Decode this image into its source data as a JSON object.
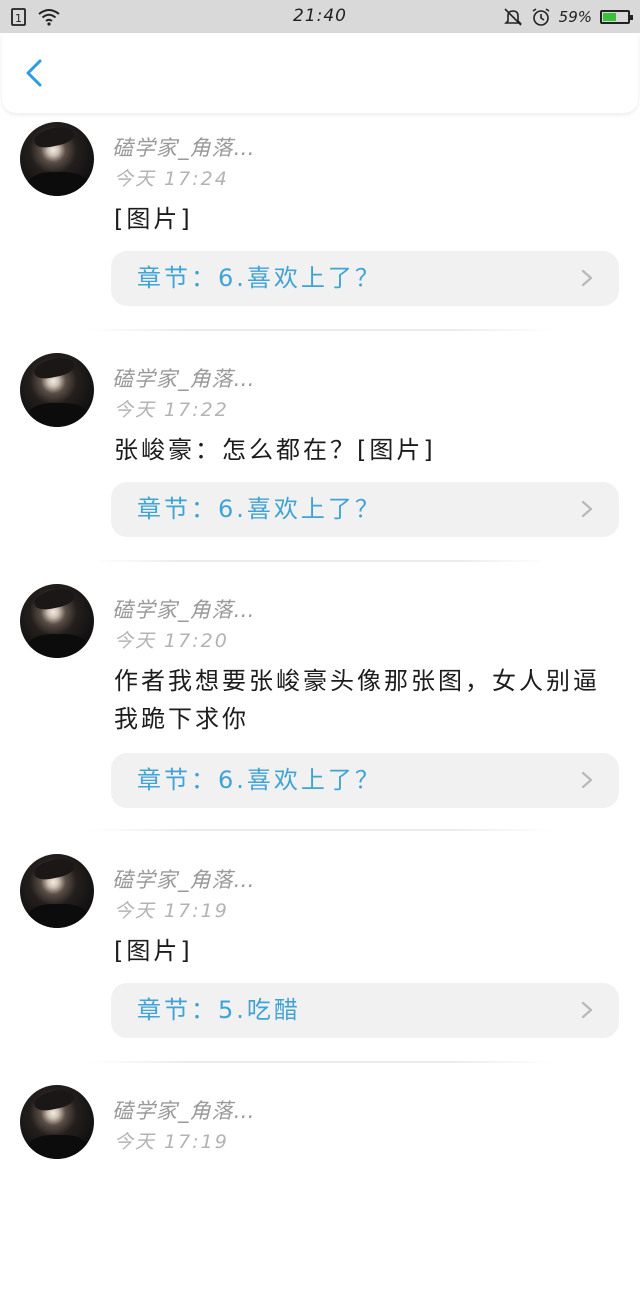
{
  "status_bar": {
    "time": "21:40",
    "battery_percent": "59%",
    "battery_level": 0.59,
    "battery_color": "#39c239",
    "icons": [
      "sim-card-icon",
      "wifi-icon",
      "mute-bell-icon",
      "alarm-clock-icon",
      "battery-icon"
    ]
  },
  "header": {
    "back_icon": "back-chevron-icon",
    "accent_color": "#2b9be8"
  },
  "comments": [
    {
      "username": "磕学家_角落…",
      "timestamp": "今天 17:24",
      "content": "[图片]",
      "chapter": "章节：6.喜欢上了？"
    },
    {
      "username": "磕学家_角落…",
      "timestamp": "今天 17:22",
      "content": "张峻豪：怎么都在？[图片]",
      "chapter": "章节：6.喜欢上了？"
    },
    {
      "username": "磕学家_角落…",
      "timestamp": "今天 17:20",
      "content": "作者我想要张峻豪头像那张图，女人别逼我跪下求你",
      "chapter": "章节：6.喜欢上了？"
    },
    {
      "username": "磕学家_角落…",
      "timestamp": "今天 17:19",
      "content": "[图片]",
      "chapter": "章节：5.吃醋"
    },
    {
      "username": "磕学家_角落…",
      "timestamp": "今天 17:19",
      "content": "",
      "chapter": ""
    }
  ]
}
